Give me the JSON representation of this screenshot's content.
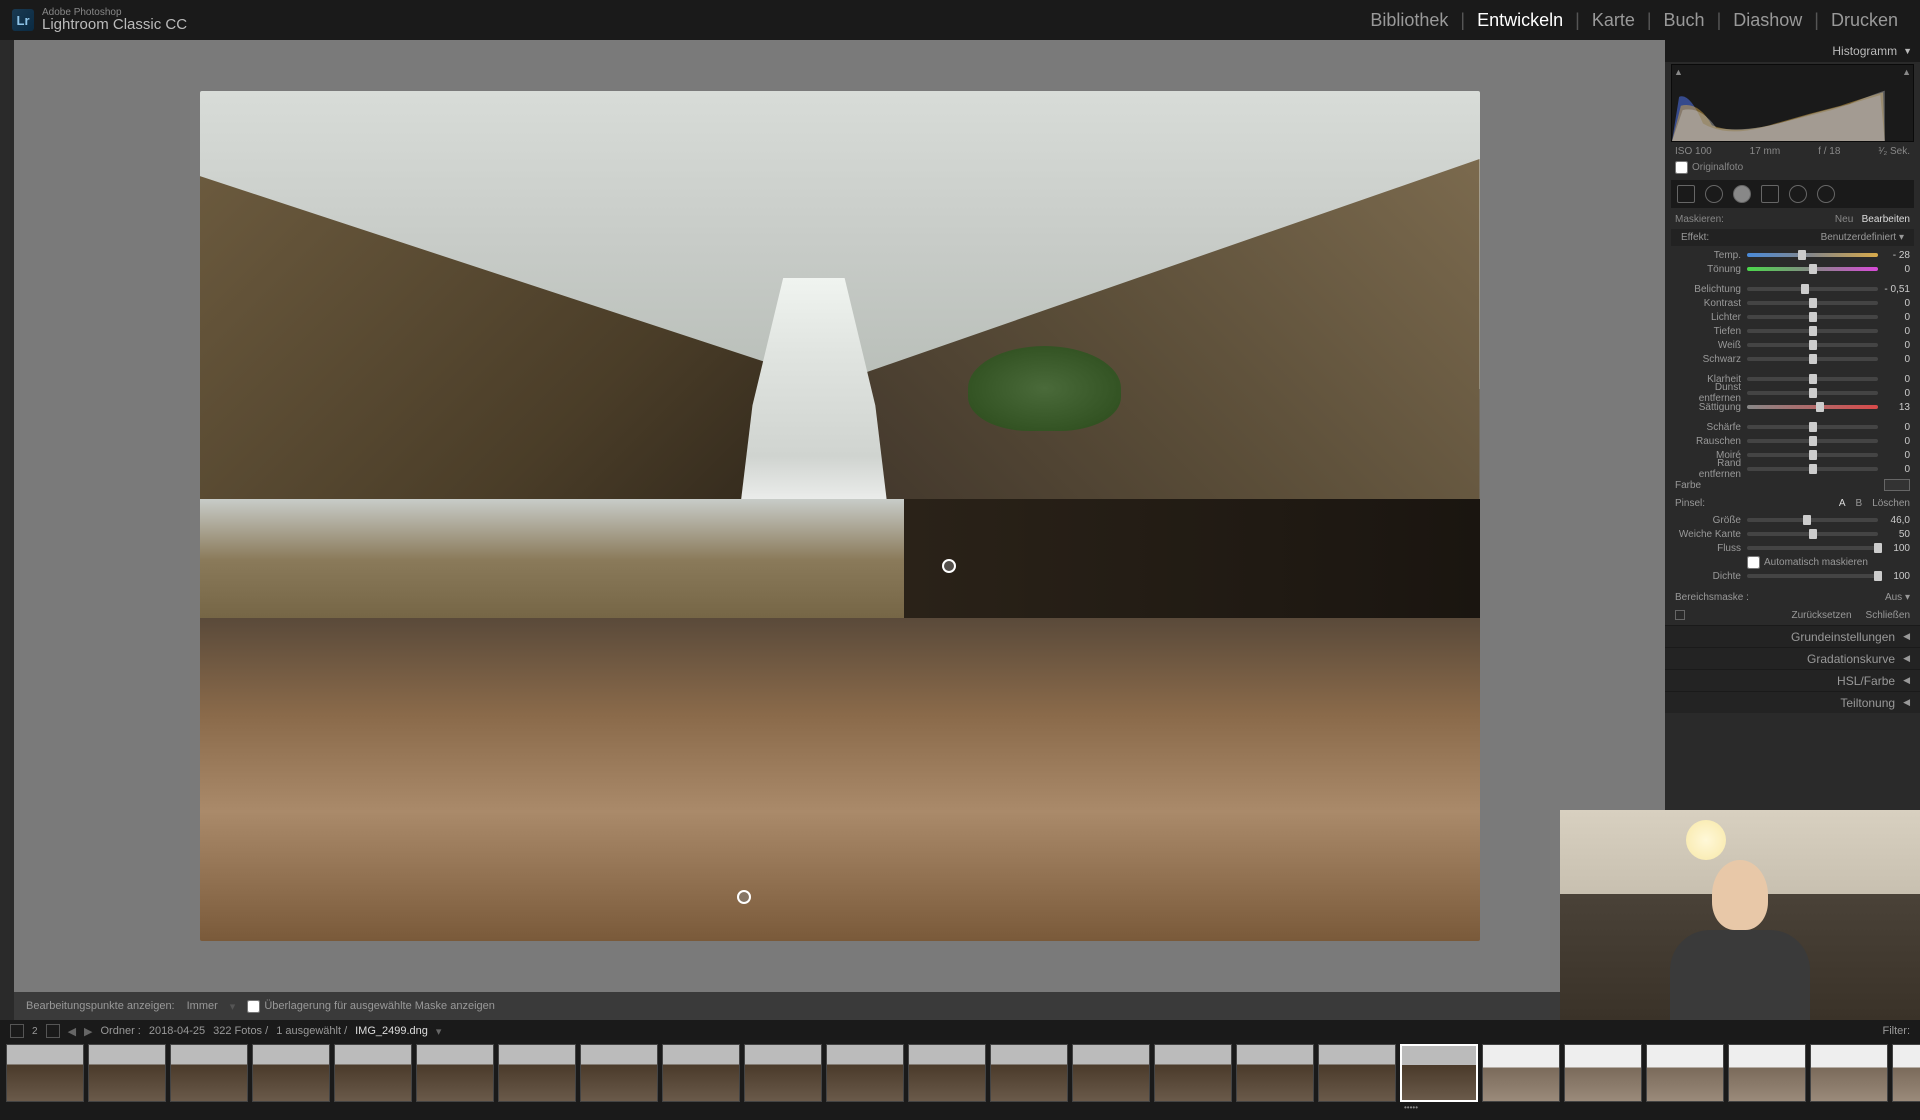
{
  "app": {
    "product_line": "Adobe Photoshop",
    "name": "Lightroom Classic CC",
    "logo_text": "Lr"
  },
  "modules": {
    "library": "Bibliothek",
    "develop": "Entwickeln",
    "map": "Karte",
    "book": "Buch",
    "slideshow": "Diashow",
    "print": "Drucken"
  },
  "toolbar": {
    "edit_points_label": "Bearbeitungspunkte anzeigen:",
    "edit_points_value": "Immer",
    "overlay_checkbox": "Überlagerung für ausgewählte Maske anzeigen"
  },
  "histogram": {
    "title": "Histogramm",
    "iso": "ISO 100",
    "focal": "17 mm",
    "aperture": "f / 18",
    "shutter": "¹⁄₂ Sek.",
    "original": "Originalfoto"
  },
  "mask": {
    "label": "Maskieren:",
    "new": "Neu",
    "edit": "Bearbeiten",
    "effect_label": "Effekt:",
    "effect_value": "Benutzerdefiniert"
  },
  "sliders": {
    "temp": {
      "label": "Temp.",
      "value": "- 28",
      "pos": 42
    },
    "tint": {
      "label": "Tönung",
      "value": "0",
      "pos": 50
    },
    "exposure": {
      "label": "Belichtung",
      "value": "- 0,51",
      "pos": 44
    },
    "contrast": {
      "label": "Kontrast",
      "value": "0",
      "pos": 50
    },
    "highlights": {
      "label": "Lichter",
      "value": "0",
      "pos": 50
    },
    "shadows": {
      "label": "Tiefen",
      "value": "0",
      "pos": 50
    },
    "whites": {
      "label": "Weiß",
      "value": "0",
      "pos": 50
    },
    "blacks": {
      "label": "Schwarz",
      "value": "0",
      "pos": 50
    },
    "clarity": {
      "label": "Klarheit",
      "value": "0",
      "pos": 50
    },
    "dehaze": {
      "label": "Dunst entfernen",
      "value": "0",
      "pos": 50
    },
    "saturation": {
      "label": "Sättigung",
      "value": "13",
      "pos": 56
    },
    "sharpness": {
      "label": "Schärfe",
      "value": "0",
      "pos": 50
    },
    "noise": {
      "label": "Rauschen",
      "value": "0",
      "pos": 50
    },
    "moire": {
      "label": "Moiré",
      "value": "0",
      "pos": 50
    },
    "defringe": {
      "label": "Rand entfernen",
      "value": "0",
      "pos": 50
    }
  },
  "color": {
    "label": "Farbe"
  },
  "brush": {
    "label": "Pinsel:",
    "tab_a": "A",
    "tab_b": "B",
    "erase": "Löschen",
    "size": {
      "label": "Größe",
      "value": "46,0",
      "pos": 46
    },
    "feather": {
      "label": "Weiche Kante",
      "value": "50",
      "pos": 50
    },
    "flow": {
      "label": "Fluss",
      "value": "100",
      "pos": 100
    },
    "automask": "Automatisch maskieren",
    "density": {
      "label": "Dichte",
      "value": "100",
      "pos": 100
    }
  },
  "range": {
    "label": "Bereichsmaske :",
    "value": "Aus"
  },
  "actions": {
    "reset": "Zurücksetzen",
    "close": "Schließen"
  },
  "panels": {
    "basic": "Grundeinstellungen",
    "tone_curve": "Gradationskurve",
    "hsl": "HSL/Farbe",
    "split": "Teiltonung"
  },
  "filmstrip": {
    "folder_label": "Ordner :",
    "folder_date": "2018-04-25",
    "count": "322 Fotos /",
    "selected": "1 ausgewählt /",
    "filename": "IMG_2499.dng",
    "filter": "Filter:"
  }
}
